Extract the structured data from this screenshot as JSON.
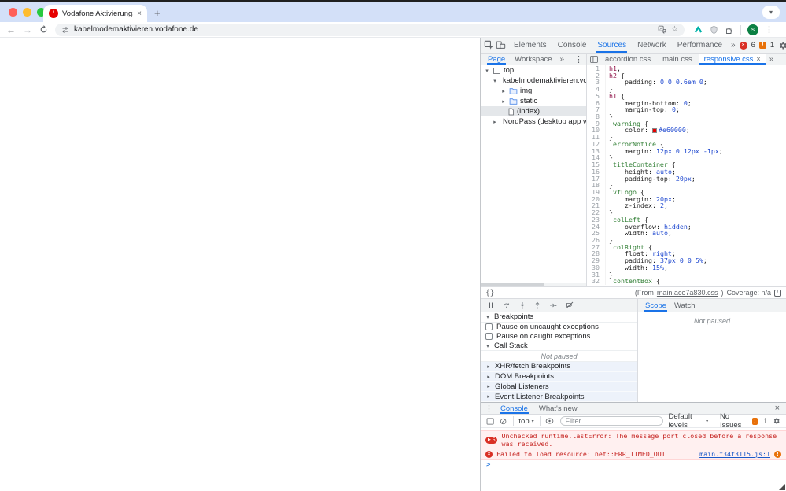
{
  "icons": {
    "more": "»",
    "kebab": "⋮",
    "close": "×",
    "star": "☆",
    "new_tab": "+",
    "back": "←",
    "forward": "→",
    "chevron_down": "▾",
    "expand": "▾",
    "collapse": "▸",
    "pretty_print": "{}",
    "prompt": ">",
    "play": "▶",
    "bang": "!",
    "cross": "×",
    "favicon_mark": "'",
    "translate": "A",
    "coverage": "▣"
  },
  "colors": {
    "accent": "#1a73e8",
    "vodafone_red": "#e60000",
    "error_red": "#d93025",
    "issue_orange": "#e8710a"
  },
  "browser": {
    "tab_title": "Vodafone Aktivierungsportal",
    "url": "kabelmodemaktivieren.vodafone.de",
    "avatar_letter": "s"
  },
  "devtools": {
    "tabs": {
      "t0": "Elements",
      "t1": "Console",
      "t2": "Sources",
      "t3": "Network",
      "t4": "Performance"
    },
    "badges": {
      "errors": "6",
      "issues": "1"
    },
    "navigator": {
      "tab_page": "Page",
      "tab_workspace": "Workspace",
      "tree": [
        {
          "label": "top"
        },
        {
          "label": "kabelmodemaktivieren.vodafor"
        },
        {
          "label": "img"
        },
        {
          "label": "static"
        },
        {
          "label": "(index)"
        },
        {
          "label": "NordPass (desktop app versio"
        }
      ]
    },
    "editor": {
      "file_tabs": {
        "f0": "accordion.css",
        "f1": "main.css",
        "f2": "responsive.css"
      },
      "lines": [
        {
          "n": "1",
          "t": [
            [
              "t",
              "h1"
            ],
            [
              "p",
              ","
            ]
          ]
        },
        {
          "n": "2",
          "t": [
            [
              "t",
              "h2"
            ],
            [
              "p",
              " {"
            ]
          ]
        },
        {
          "n": "3",
          "t": [
            [
              "p",
              "    padding: "
            ],
            [
              "v",
              "0 0 0.6em 0"
            ],
            [
              "p",
              ";"
            ]
          ]
        },
        {
          "n": "4",
          "t": [
            [
              "p",
              "}"
            ]
          ]
        },
        {
          "n": "5",
          "t": [
            [
              "t",
              "h1"
            ],
            [
              "p",
              " {"
            ]
          ]
        },
        {
          "n": "6",
          "t": [
            [
              "p",
              "    margin-bottom: "
            ],
            [
              "v",
              "0"
            ],
            [
              "p",
              ";"
            ]
          ]
        },
        {
          "n": "7",
          "t": [
            [
              "p",
              "    margin-top: "
            ],
            [
              "v",
              "0"
            ],
            [
              "p",
              ";"
            ]
          ]
        },
        {
          "n": "8",
          "t": [
            [
              "p",
              "}"
            ]
          ]
        },
        {
          "n": "9",
          "t": [
            [
              "c",
              ".warning"
            ],
            [
              "p",
              " {"
            ]
          ]
        },
        {
          "n": "10",
          "t": [
            [
              "p",
              "    color: "
            ],
            [
              "w",
              "#e60000"
            ],
            [
              "p",
              ";"
            ]
          ]
        },
        {
          "n": "11",
          "t": [
            [
              "p",
              "}"
            ]
          ]
        },
        {
          "n": "12",
          "t": [
            [
              "c",
              ".errorNotice"
            ],
            [
              "p",
              " {"
            ]
          ]
        },
        {
          "n": "13",
          "t": [
            [
              "p",
              "    margin: "
            ],
            [
              "v",
              "12px 0 12px -1px"
            ],
            [
              "p",
              ";"
            ]
          ]
        },
        {
          "n": "14",
          "t": [
            [
              "p",
              "}"
            ]
          ]
        },
        {
          "n": "15",
          "t": [
            [
              "c",
              ".titleContainer"
            ],
            [
              "p",
              " {"
            ]
          ]
        },
        {
          "n": "16",
          "t": [
            [
              "p",
              "    height: "
            ],
            [
              "v",
              "auto"
            ],
            [
              "p",
              ";"
            ]
          ]
        },
        {
          "n": "17",
          "t": [
            [
              "p",
              "    padding-top: "
            ],
            [
              "v",
              "20px"
            ],
            [
              "p",
              ";"
            ]
          ]
        },
        {
          "n": "18",
          "t": [
            [
              "p",
              "}"
            ]
          ]
        },
        {
          "n": "19",
          "t": [
            [
              "c",
              ".vfLogo"
            ],
            [
              "p",
              " {"
            ]
          ]
        },
        {
          "n": "20",
          "t": [
            [
              "p",
              "    margin: "
            ],
            [
              "v",
              "20px"
            ],
            [
              "p",
              ";"
            ]
          ]
        },
        {
          "n": "21",
          "t": [
            [
              "p",
              "    z-index: "
            ],
            [
              "v",
              "2"
            ],
            [
              "p",
              ";"
            ]
          ]
        },
        {
          "n": "22",
          "t": [
            [
              "p",
              "}"
            ]
          ]
        },
        {
          "n": "23",
          "t": [
            [
              "c",
              ".colLeft"
            ],
            [
              "p",
              " {"
            ]
          ]
        },
        {
          "n": "24",
          "t": [
            [
              "p",
              "    overflow: "
            ],
            [
              "v",
              "hidden"
            ],
            [
              "p",
              ";"
            ]
          ]
        },
        {
          "n": "25",
          "t": [
            [
              "p",
              "    width: "
            ],
            [
              "v",
              "auto"
            ],
            [
              "p",
              ";"
            ]
          ]
        },
        {
          "n": "26",
          "t": [
            [
              "p",
              "}"
            ]
          ]
        },
        {
          "n": "27",
          "t": [
            [
              "c",
              ".colRight"
            ],
            [
              "p",
              " {"
            ]
          ]
        },
        {
          "n": "28",
          "t": [
            [
              "p",
              "    float: "
            ],
            [
              "v",
              "right"
            ],
            [
              "p",
              ";"
            ]
          ]
        },
        {
          "n": "29",
          "t": [
            [
              "p",
              "    padding: "
            ],
            [
              "v",
              "37px 0 0 5%"
            ],
            [
              "p",
              ";"
            ]
          ]
        },
        {
          "n": "30",
          "t": [
            [
              "p",
              "    width: "
            ],
            [
              "v",
              "15%"
            ],
            [
              "p",
              ";"
            ]
          ]
        },
        {
          "n": "31",
          "t": [
            [
              "p",
              "}"
            ]
          ]
        },
        {
          "n": "32",
          "t": [
            [
              "c",
              ".contentBox"
            ],
            [
              "p",
              " {"
            ]
          ]
        }
      ],
      "status": {
        "pretty": "{}",
        "from_prefix": "(From ",
        "link": "main.ace7a830.css",
        "suffix": ")",
        "coverage": "Coverage: n/a"
      }
    },
    "debugger": {
      "breakpoints_title": "Breakpoints",
      "cb0": "Pause on uncaught exceptions",
      "cb1": "Pause on caught exceptions",
      "callstack_title": "Call Stack",
      "not_paused": "Not paused",
      "s0": "XHR/fetch Breakpoints",
      "s1": "DOM Breakpoints",
      "s2": "Global Listeners",
      "s3": "Event Listener Breakpoints",
      "scope_tab": "Scope",
      "watch_tab": "Watch",
      "scope_not_paused": "Not paused"
    },
    "drawer": {
      "tab_console": "Console",
      "tab_whats_new": "What's new",
      "context": "top",
      "filter_placeholder": "Filter",
      "levels": "Default levels",
      "no_issues": "No Issues",
      "issue_count": "1",
      "msg1_count": "5",
      "msg1_text": "Unchecked runtime.lastError: The message port closed before a response was received.",
      "msg2_text": "Failed to load resource: net::ERR_TIMED_OUT",
      "msg2_link": "main.f34f3115.js:1"
    }
  }
}
